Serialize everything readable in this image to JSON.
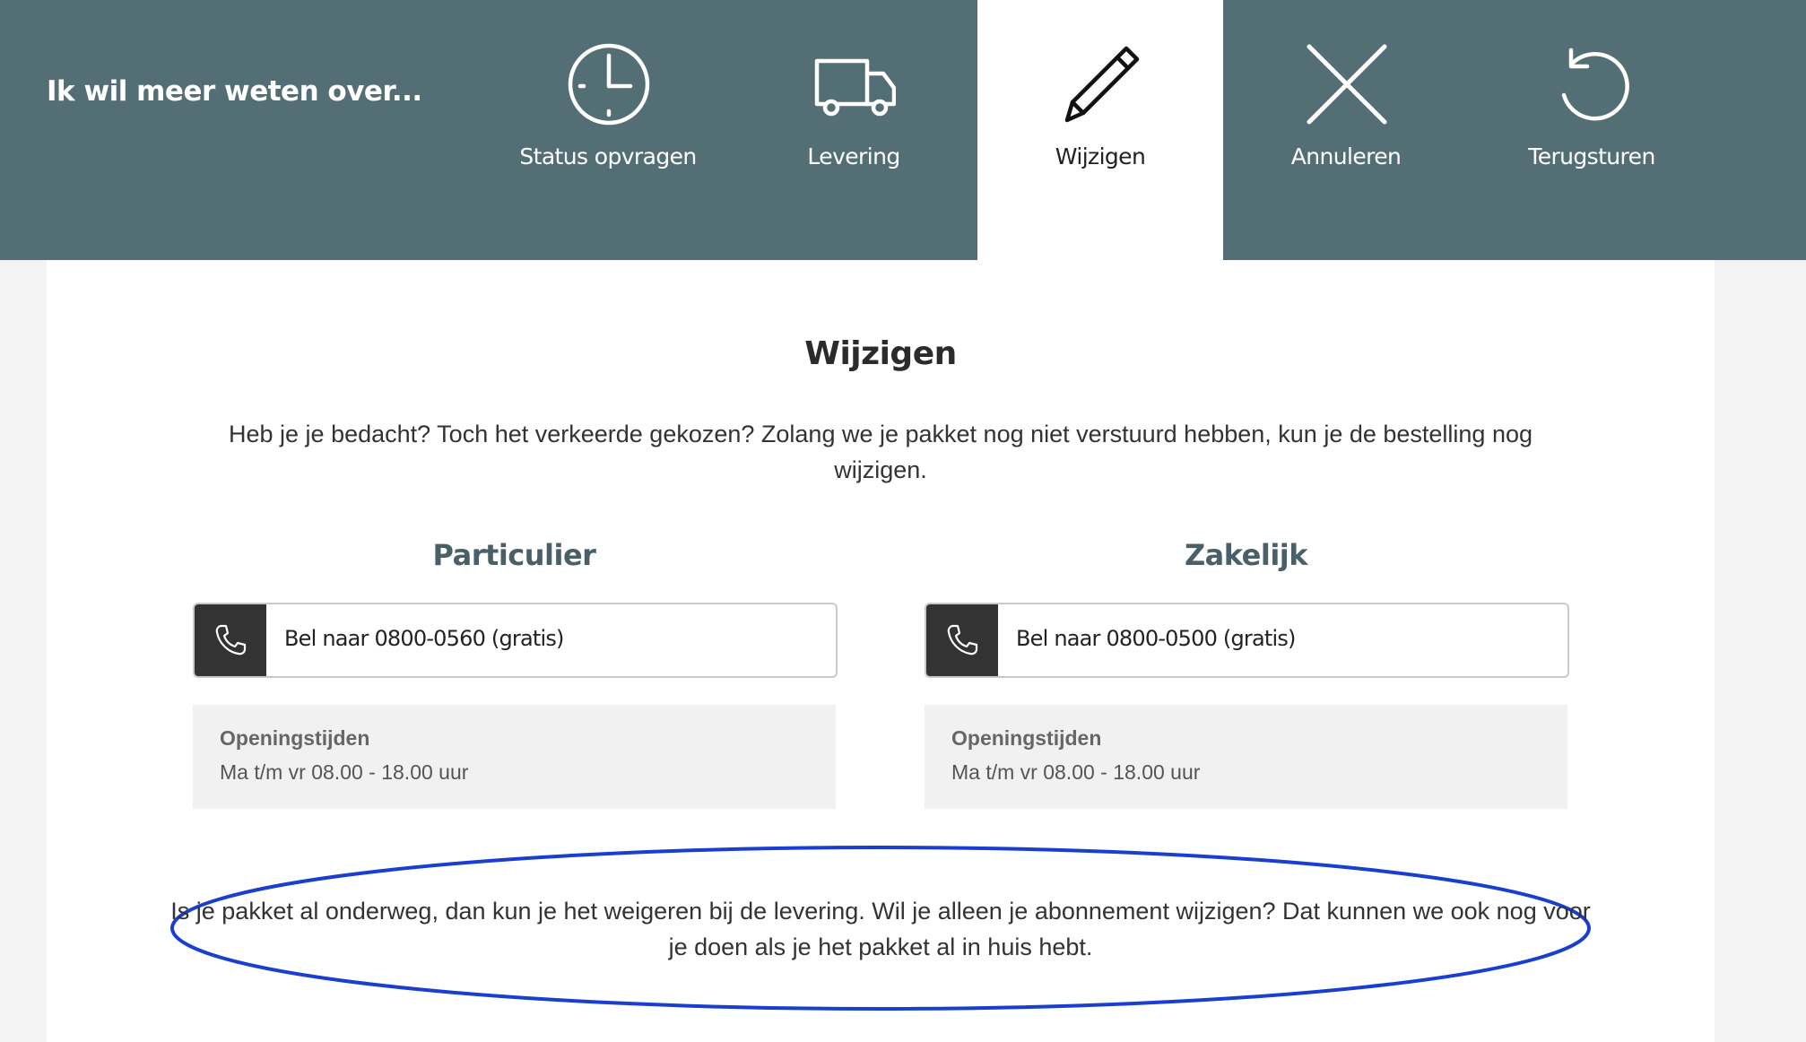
{
  "header": {
    "title": "Ik wil meer weten over...",
    "tabs": [
      {
        "label": "Status opvragen",
        "icon": "clock-icon",
        "active": false
      },
      {
        "label": "Levering",
        "icon": "truck-icon",
        "active": false
      },
      {
        "label": "Wijzigen",
        "icon": "pencil-icon",
        "active": true
      },
      {
        "label": "Annuleren",
        "icon": "close-icon",
        "active": false
      },
      {
        "label": "Terugsturen",
        "icon": "return-arrow-icon",
        "active": false
      }
    ]
  },
  "content": {
    "title": "Wijzigen",
    "intro": "Heb je je bedacht? Toch het verkeerde gekozen? Zolang we je pakket nog niet verstuurd hebben, kun je de bestelling nog wijzigen.",
    "columns": [
      {
        "title": "Particulier",
        "call_label": "Bel naar 0800-0560 (gratis)",
        "hours_title": "Openingstijden",
        "hours_text": "Ma t/m vr 08.00 - 18.00 uur"
      },
      {
        "title": "Zakelijk",
        "call_label": "Bel naar 0800-0500 (gratis)",
        "hours_title": "Openingstijden",
        "hours_text": "Ma t/m vr 08.00 - 18.00 uur"
      }
    ],
    "note": "Is je pakket al onderweg, dan kun je het weigeren bij de levering. Wil je alleen je abonnement wijzigen? Dat kunnen we ook nog voor je doen als je het pakket al in huis hebt."
  },
  "colors": {
    "header_bg": "#546e75",
    "active_tab_bg": "#ffffff",
    "column_title": "#4a6068",
    "call_icon_bg": "#333333",
    "hours_bg": "#f1f1f1",
    "annotation_ellipse": "#1a3fcf"
  }
}
